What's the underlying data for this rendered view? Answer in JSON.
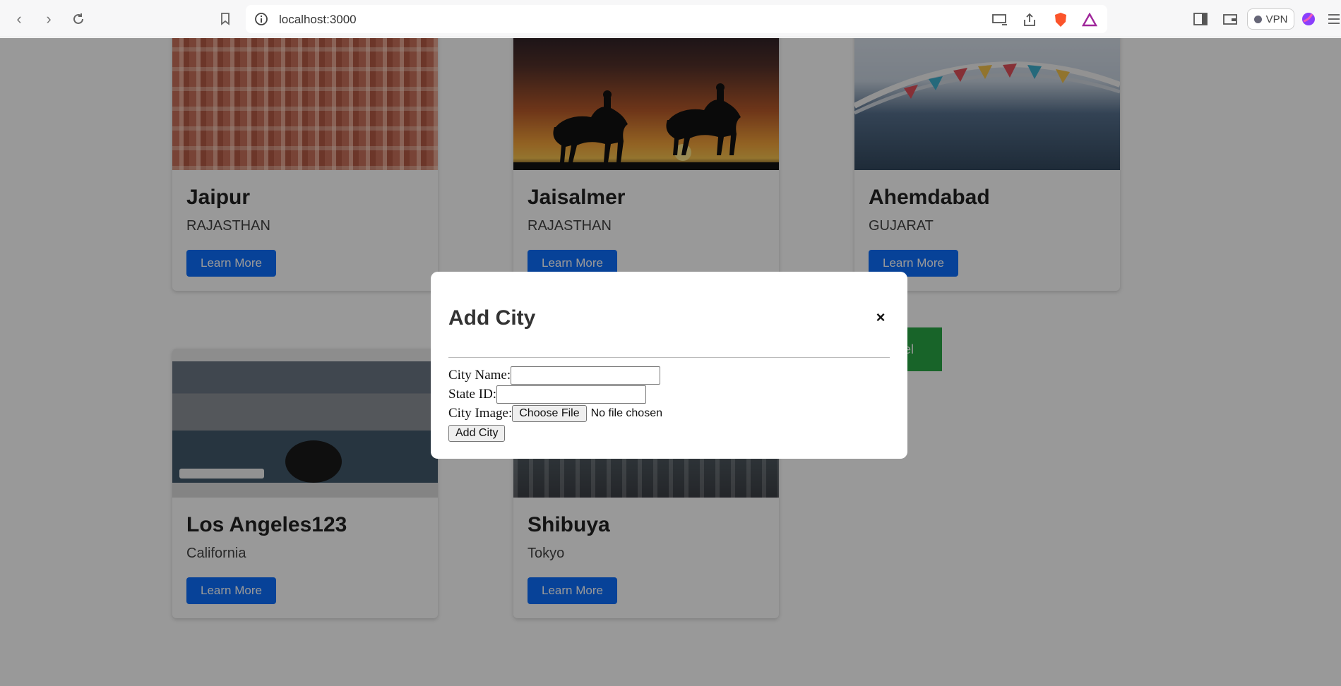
{
  "browser": {
    "url": "localhost:3000",
    "vpn_label": "VPN"
  },
  "cards": [
    {
      "city": "Jaipur",
      "state": "RAJASTHAN",
      "button": "Learn More",
      "image": "hawa-mahal-photo"
    },
    {
      "city": "Jaisalmer",
      "state": "RAJASTHAN",
      "button": "Learn More",
      "image": "camel-desert-sunset-photo"
    },
    {
      "city": "Ahemdabad",
      "state": "GUJARAT",
      "button": "Learn More",
      "image": "footbridge-river-photo"
    },
    {
      "city": "Los Angeles123",
      "state": "California",
      "button": "Learn More",
      "image": "venice-gondola-screenshot"
    },
    {
      "city": "Shibuya",
      "state": "Tokyo",
      "button": "Learn More",
      "image": "tokyo-skyline-photo"
    }
  ],
  "green_button": {
    "label": "el"
  },
  "modal": {
    "title": "Add City",
    "close_symbol": "×",
    "fields": {
      "city_name_label": "City Name:",
      "state_id_label": "State ID:",
      "city_image_label": "City Image:",
      "file_button": "Choose File",
      "file_status": "No file chosen"
    },
    "submit_label": "Add City"
  },
  "colors": {
    "primary": "#0d6efd",
    "success": "#28a745"
  }
}
